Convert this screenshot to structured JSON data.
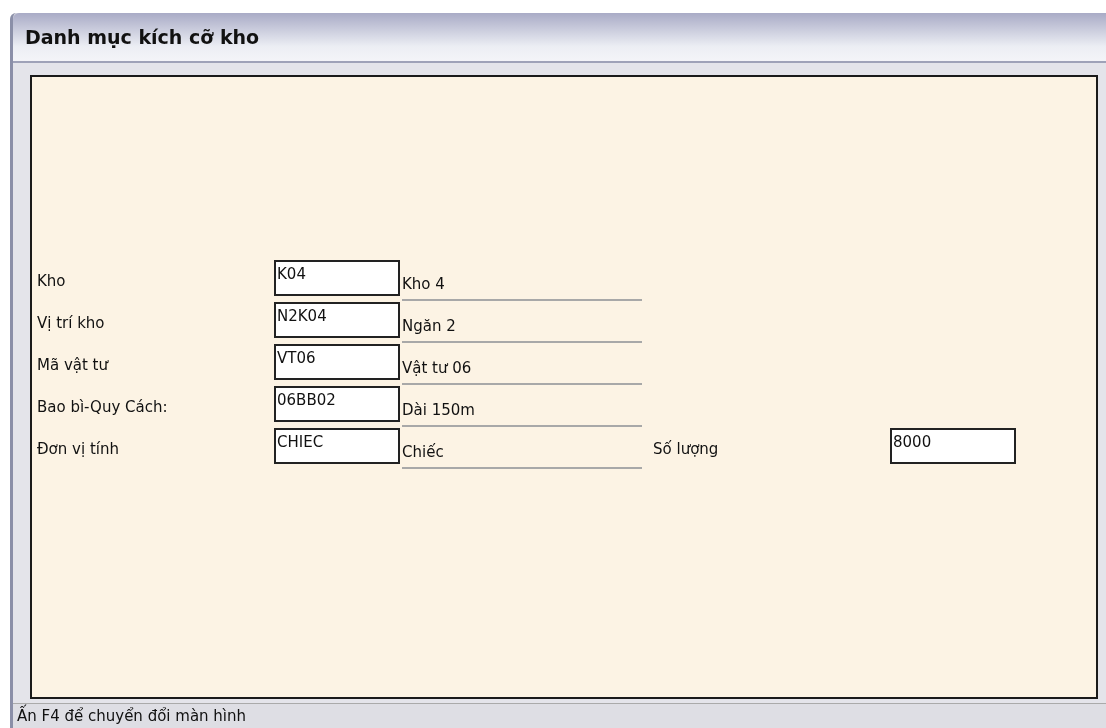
{
  "window": {
    "title": "Danh mục kích cỡ kho"
  },
  "fields": [
    {
      "label": "Kho",
      "value": "K04",
      "description": "Kho 4"
    },
    {
      "label": "Vị trí kho",
      "value": "N2K04",
      "description": "Ngăn 2"
    },
    {
      "label": "Mã vật tư",
      "value": "VT06",
      "description": "Vật tư 06"
    },
    {
      "label": "Bao bì-Quy Cách:",
      "value": "06BB02",
      "description": "Dài 150m"
    },
    {
      "label": "Đơn vị tính",
      "value": "CHIEC",
      "description": "Chiếc",
      "extra": {
        "label": "Số lượng",
        "value": "8000"
      }
    }
  ],
  "status_bar": "Ấn F4 để chuyển đổi màn hình"
}
